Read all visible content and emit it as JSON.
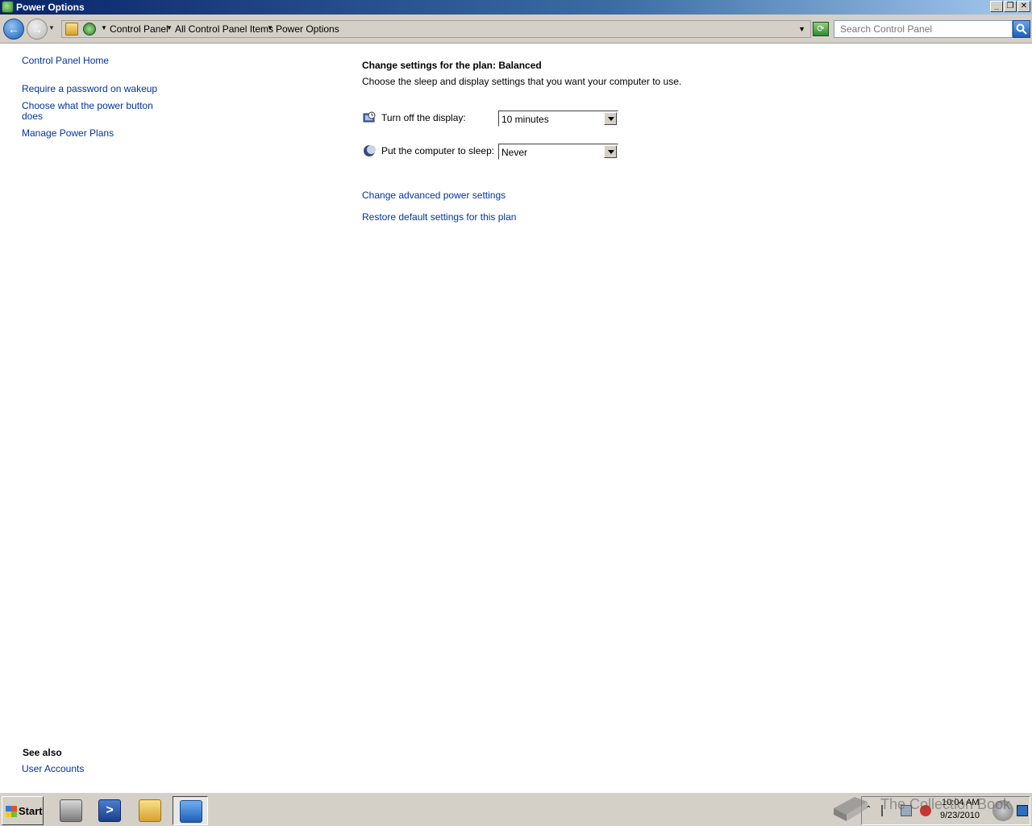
{
  "window": {
    "title": "Power Options"
  },
  "address_bar": {
    "breadcrumbs": [
      "Control Panel",
      "All Control Panel Items",
      "Power Options"
    ],
    "search_placeholder": "Search Control Panel"
  },
  "left_pane": {
    "links": [
      "Control Panel Home",
      "Require a password on wakeup",
      "Choose what the power button does",
      "Manage Power Plans"
    ],
    "see_also_heading": "See also",
    "see_also_links": [
      "User Accounts"
    ]
  },
  "main": {
    "heading": "Change settings for the plan: Balanced",
    "description": "Choose the sleep and display settings that you want your computer to use.",
    "settings": [
      {
        "label": "Turn off the display:",
        "value": "10 minutes",
        "icon": "monitor-clock-icon"
      },
      {
        "label": "Put the computer to sleep:",
        "value": "Never",
        "icon": "moon-icon"
      }
    ],
    "links": [
      "Change advanced power settings",
      "Restore default settings for this plan"
    ]
  },
  "taskbar": {
    "start_label": "Start",
    "apps": [
      "server-manager-icon",
      "powershell-icon",
      "explorer-icon",
      "control-panel-icon"
    ],
    "clock_time": "10:04 AM",
    "clock_date": "9/23/2010"
  },
  "watermark": {
    "text": "The Collection Book"
  }
}
